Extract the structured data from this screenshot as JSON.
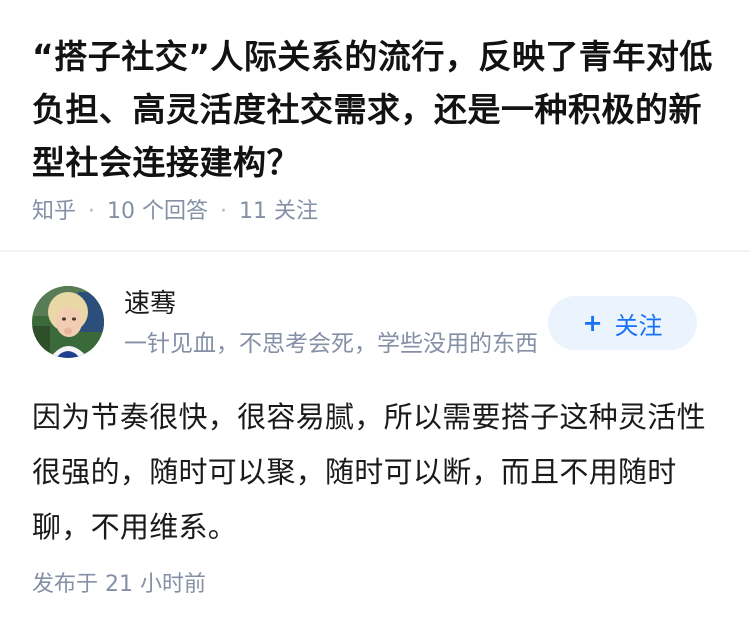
{
  "question": {
    "title": "“搭子社交”人际关系的流行，反映了青年对低负担、高灵活度社交需求，还是一种积极的新型社会连接建构？",
    "source": "知乎",
    "answer_count": "10 个回答",
    "follower_count": "11 关注"
  },
  "answer": {
    "author_name": "速骞",
    "author_bio": "一针见血，不思考会死，学些没用的东西",
    "follow_label": "关注",
    "follow_icon": "plus-icon",
    "content": "因为节奏很快，很容易腻，所以需要搭子这种灵活性很强的，随时可以聚，随时可以断，而且不用随时聊，不用维系。",
    "published": "发布于 21 小时前"
  },
  "colors": {
    "accent": "#1772f6",
    "follow_bg": "#ebf3fd",
    "meta_text": "#8590a6"
  }
}
